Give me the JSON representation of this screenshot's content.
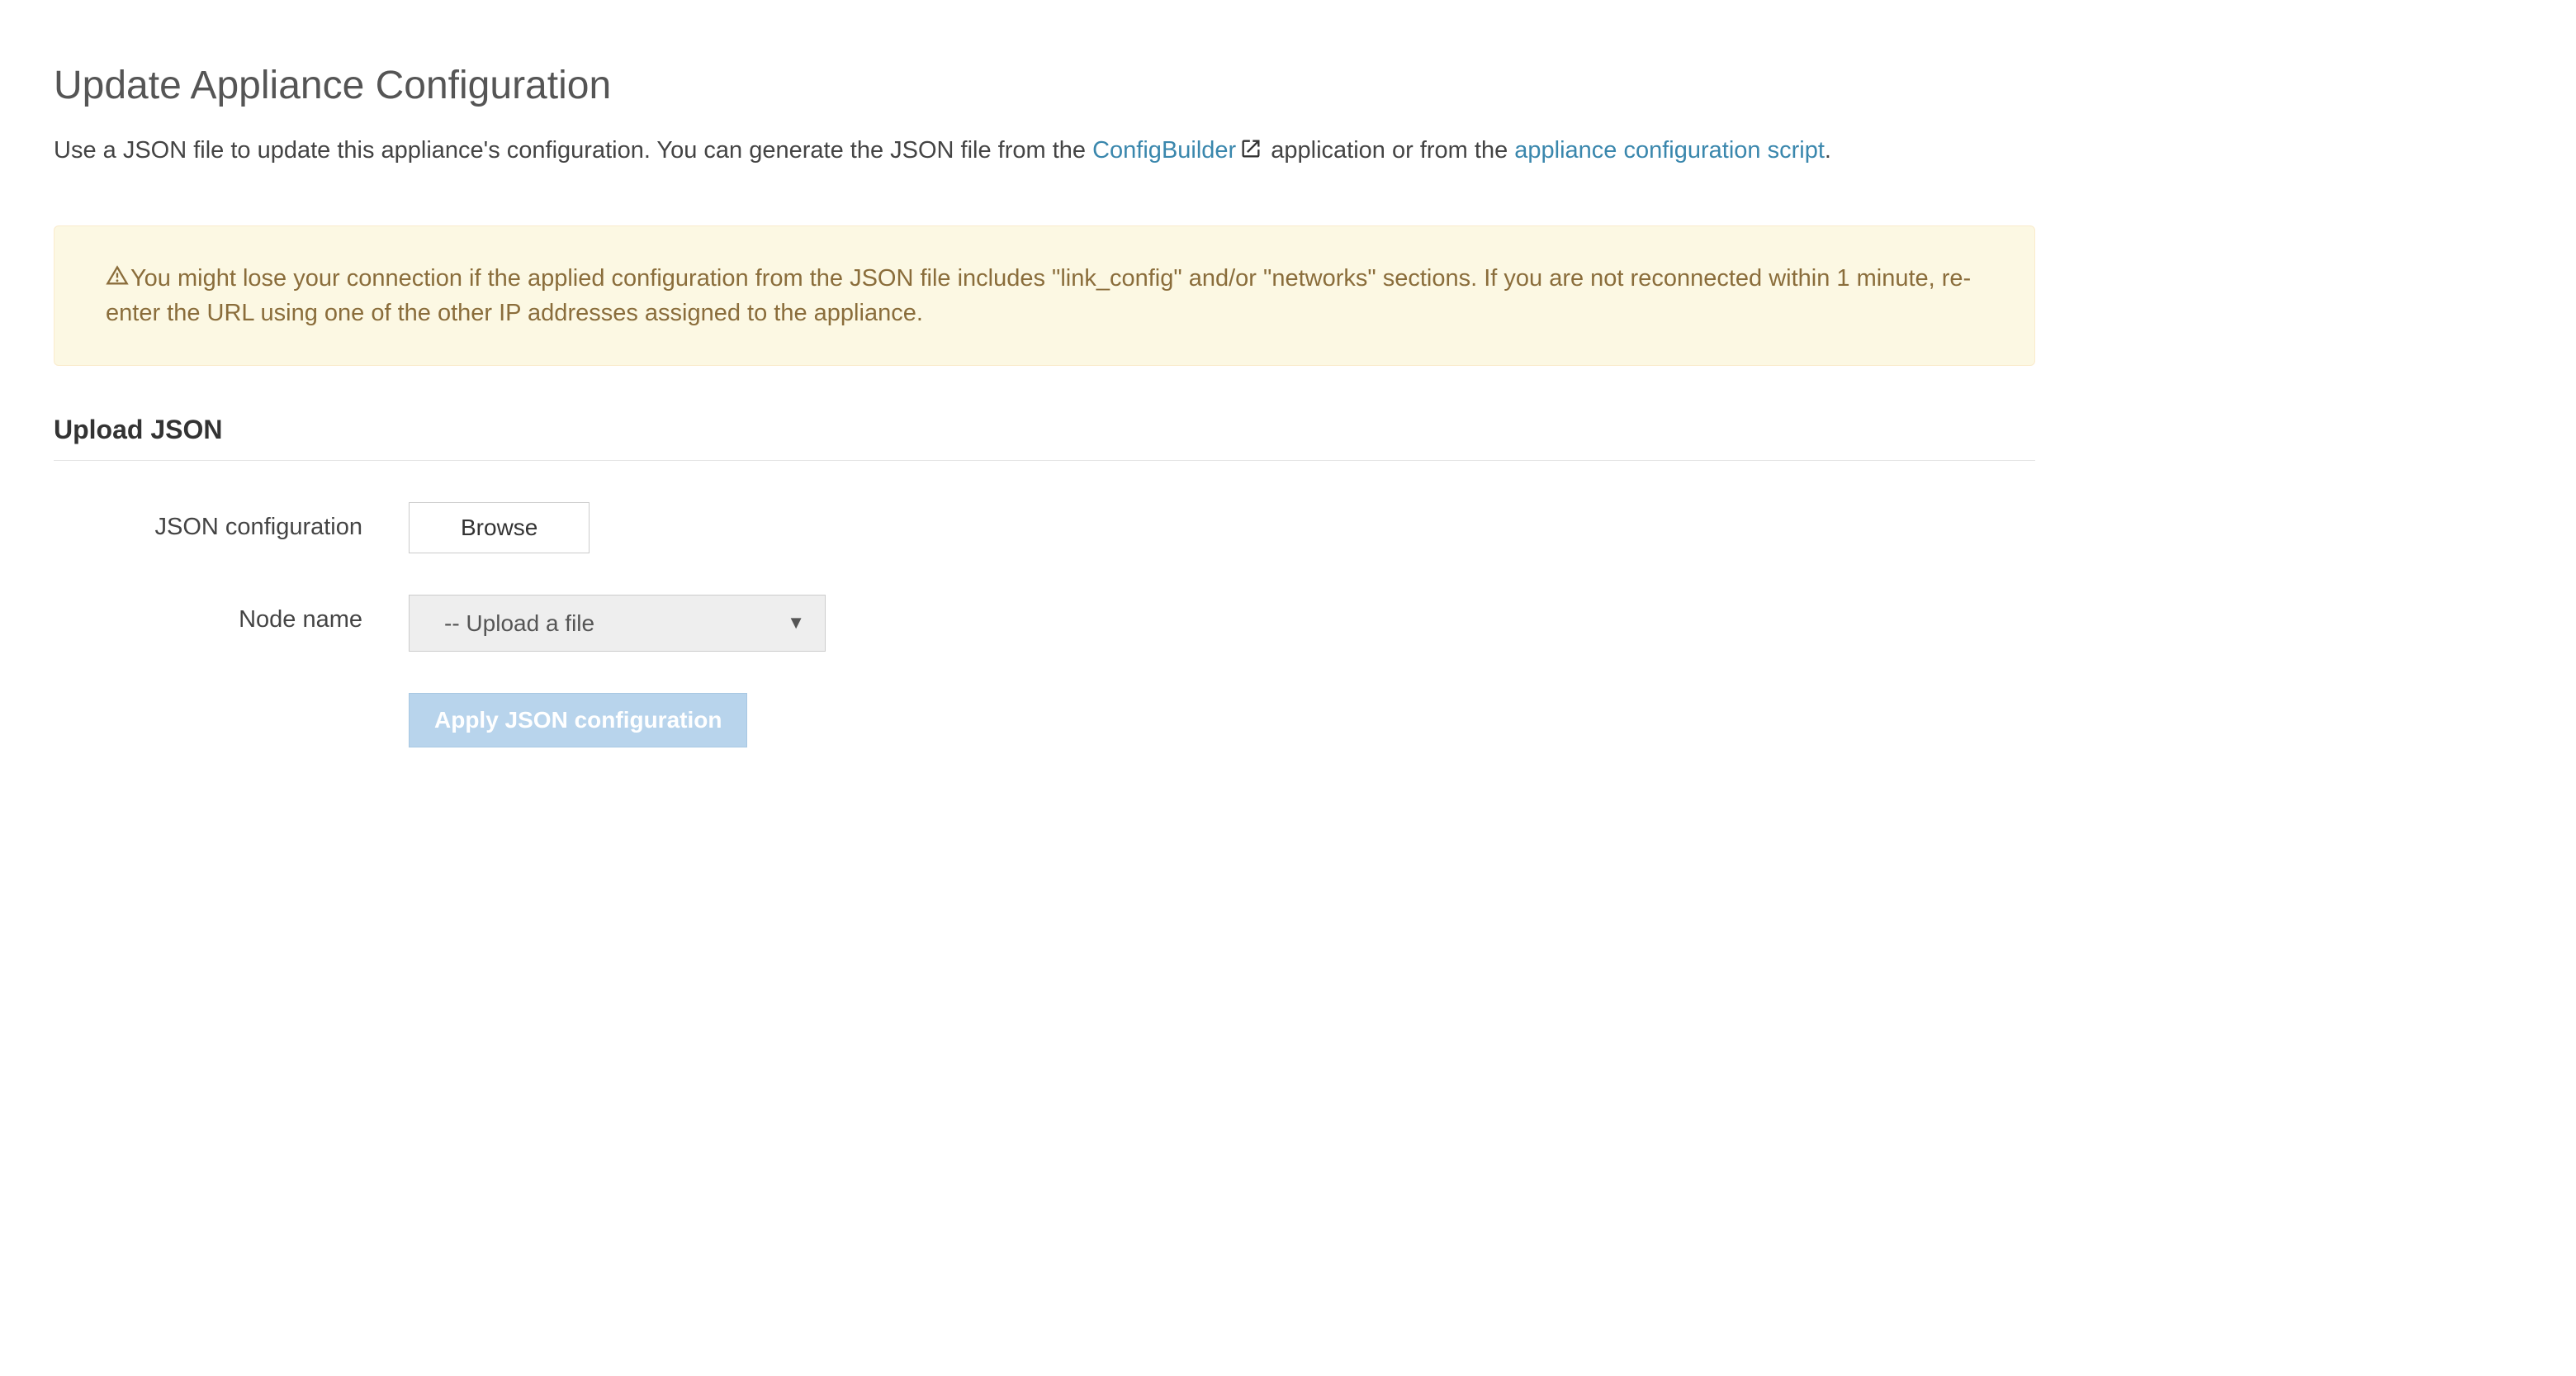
{
  "page_title": "Update Appliance Configuration",
  "intro": {
    "part1": "Use a JSON file to update this appliance's configuration. You can generate the JSON file from the ",
    "link1": "ConfigBuilder",
    "part2": " application or from the ",
    "link2": "appliance configuration script",
    "part3": "."
  },
  "alert": {
    "text": "You might lose your connection if the applied configuration from the JSON file includes \"link_config\" and/or \"networks\" sections. If you are not reconnected within 1 minute, re-enter the URL using one of the other IP addresses assigned to the appliance."
  },
  "section": {
    "upload_title": "Upload JSON",
    "json_config_label": "JSON configuration",
    "browse_button": "Browse",
    "node_name_label": "Node name",
    "node_name_selected": "-- Upload a file",
    "apply_button": "Apply JSON configuration"
  }
}
